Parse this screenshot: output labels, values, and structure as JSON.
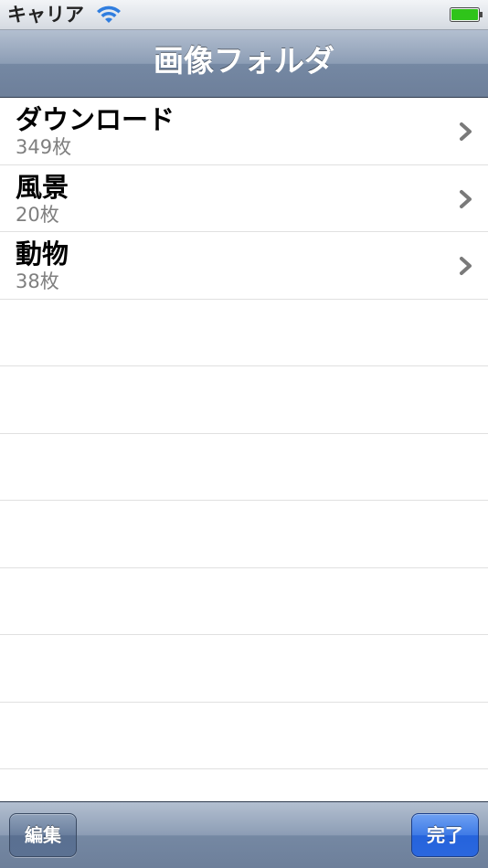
{
  "status_bar": {
    "carrier": "キャリア",
    "wifi_icon": "wifi-icon",
    "battery_icon": "battery-full-icon",
    "battery_color": "#2fc41a"
  },
  "nav_bar": {
    "title": "画像フォルダ"
  },
  "folders": [
    {
      "name": "ダウンロード",
      "count": "349枚"
    },
    {
      "name": "風景",
      "count": "20枚"
    },
    {
      "name": "動物",
      "count": "38枚"
    }
  ],
  "toolbar": {
    "edit_label": "編集",
    "done_label": "完了"
  },
  "colors": {
    "bar_blue": "#7588a3",
    "done_blue": "#2563dc",
    "subtitle_gray": "#7f7f7f",
    "separator": "#e0e0e0"
  }
}
